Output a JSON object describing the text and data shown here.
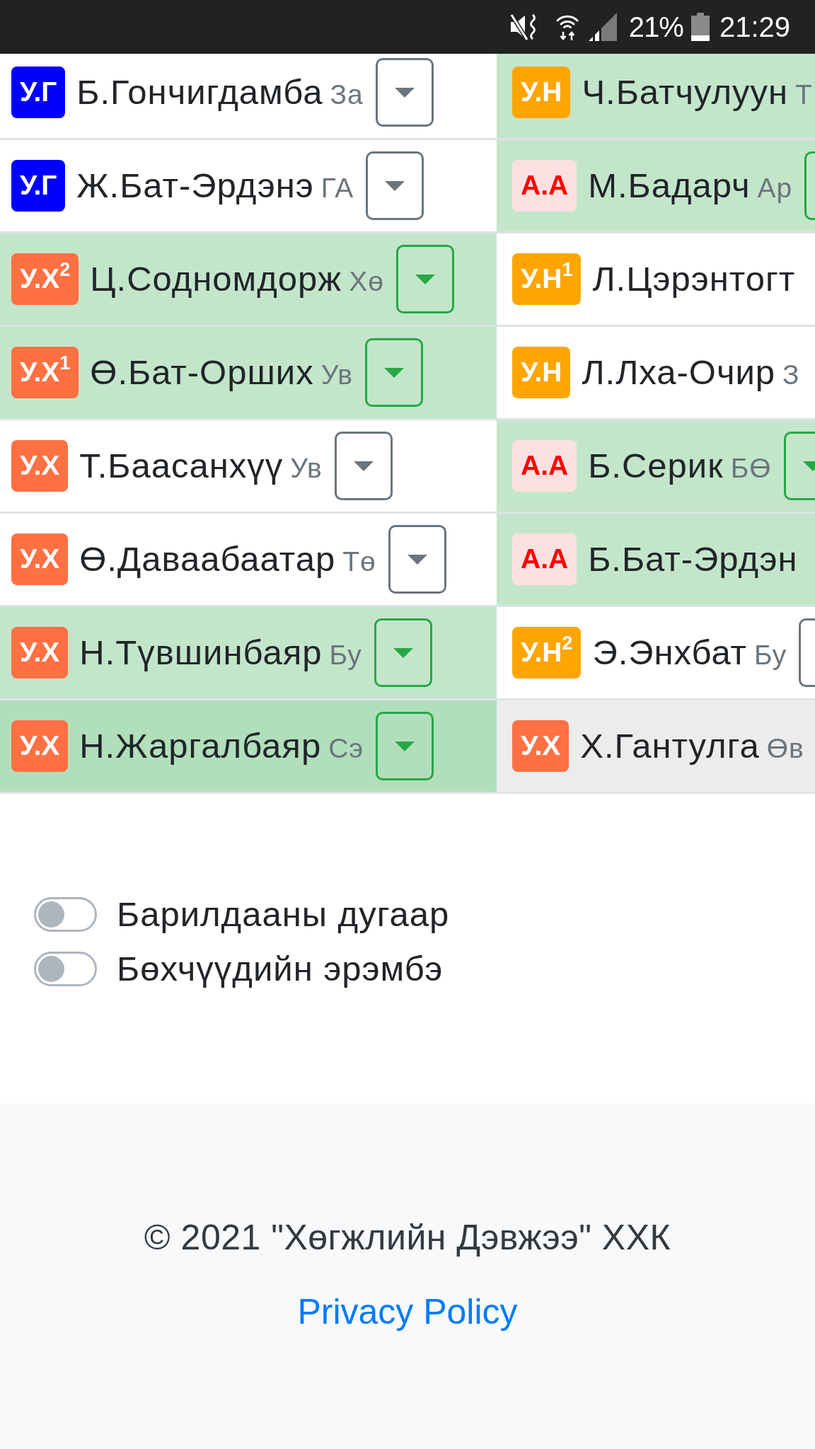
{
  "status_bar": {
    "battery": "21%",
    "time": "21:29"
  },
  "matches": [
    {
      "hovered": false,
      "wrestlers": [
        {
          "rank": "У.Г",
          "kind": "solid",
          "color": "#0000ff",
          "name": "Б.Гончигдамба",
          "province": "За",
          "winner": false,
          "dropdown": true
        },
        {
          "rank": "У.Н",
          "kind": "solid",
          "color": "#ffa500",
          "name": "Ч.Батчулуун",
          "province": "Т",
          "winner": true,
          "dropdown": false
        }
      ]
    },
    {
      "hovered": false,
      "wrestlers": [
        {
          "rank": "У.Г",
          "kind": "solid",
          "color": "#0000ff",
          "name": "Ж.Бат-Эрдэнэ",
          "province": "ГА",
          "winner": false,
          "dropdown": true
        },
        {
          "rank": "А.А",
          "kind": "soft",
          "color": "#ff0000",
          "name": "М.Бадарч",
          "province": "Ар",
          "winner": true,
          "dropdown": true
        }
      ]
    },
    {
      "hovered": false,
      "wrestlers": [
        {
          "rank": "У.Х$^{2}$",
          "kind": "solid",
          "color": "#ff7043",
          "name": "Ц.Содномдорж",
          "province": "Хө",
          "winner": true,
          "dropdown": true
        },
        {
          "rank": "У.Н$^{1}$",
          "kind": "solid",
          "color": "#ffa500",
          "name": "Л.Цэрэнтогт",
          "winner": false,
          "dropdown": false
        }
      ]
    },
    {
      "hovered": false,
      "wrestlers": [
        {
          "rank": "У.Х$^{1}$",
          "kind": "solid",
          "color": "#ff7043",
          "name": "Ө.Бат-Орших",
          "province": "Ув",
          "winner": true,
          "dropdown": true
        },
        {
          "rank": "У.Н",
          "kind": "solid",
          "color": "#ffa500",
          "name": "Л.Лха-Очир",
          "province": "З",
          "winner": false,
          "dropdown": false
        }
      ]
    },
    {
      "hovered": false,
      "wrestlers": [
        {
          "rank": "У.Х",
          "kind": "solid",
          "color": "#ff7043",
          "name": "Т.Баасанхүү",
          "province": "Ув",
          "winner": false,
          "dropdown": true
        },
        {
          "rank": "А.А",
          "kind": "soft",
          "color": "#ff0000",
          "name": "Б.Серик",
          "province": "БӨ",
          "winner": true,
          "dropdown": true
        }
      ]
    },
    {
      "hovered": false,
      "wrestlers": [
        {
          "rank": "У.Х",
          "kind": "solid",
          "color": "#ff7043",
          "name": "Ө.Даваабаатар",
          "province": "Тө",
          "winner": false,
          "dropdown": true
        },
        {
          "rank": "А.А",
          "kind": "soft",
          "color": "#ff0000",
          "name": "Б.Бат-Эрдэн",
          "winner": true,
          "dropdown": false
        }
      ]
    },
    {
      "hovered": false,
      "wrestlers": [
        {
          "rank": "У.Х",
          "kind": "solid",
          "color": "#ff7043",
          "name": "Н.Түвшинбаяр",
          "province": "Бу",
          "winner": true,
          "dropdown": true
        },
        {
          "rank": "У.Н$^{2}$",
          "kind": "solid",
          "color": "#ffa500",
          "name": "Э.Энхбат",
          "province": "Бу",
          "winner": false,
          "dropdown": true
        }
      ]
    },
    {
      "hovered": true,
      "wrestlers": [
        {
          "rank": "У.Х",
          "kind": "solid",
          "color": "#ff7043",
          "name": "Н.Жаргалбаяр",
          "province": "Сэ",
          "winner": true,
          "dropdown": true
        },
        {
          "rank": "У.Х",
          "kind": "solid",
          "color": "#ff7043",
          "name": "Х.Гантулга",
          "province": "Өв",
          "winner": false,
          "dropdown": false
        }
      ]
    }
  ],
  "toggles": [
    {
      "label": "Барилдааны дугаар",
      "on": false
    },
    {
      "label": "Бөхчүүдийн эрэмбэ",
      "on": false
    }
  ],
  "footer": {
    "copyright": "© 2021 \"Хөгжлийн Дэвжээ\" ХХК",
    "link": "Privacy Policy"
  }
}
